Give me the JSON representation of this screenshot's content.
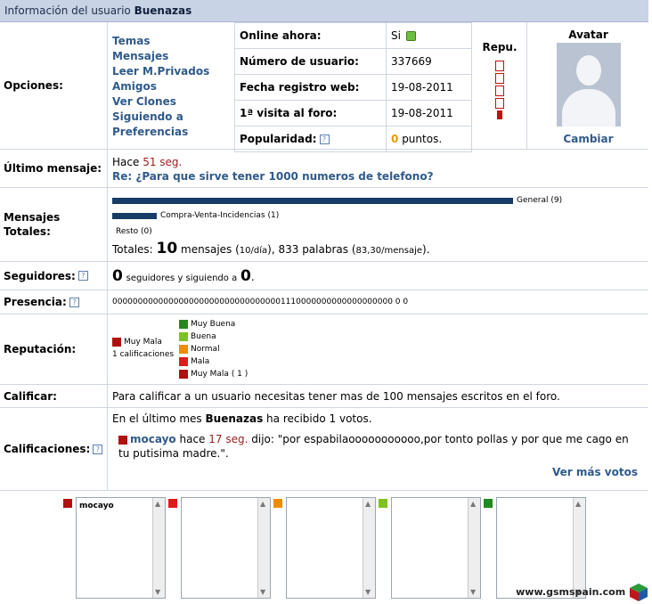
{
  "header": {
    "prefix": "Información del usuario",
    "username": "Buenazas"
  },
  "options": {
    "label": "Opciones:",
    "links": [
      "Temas",
      "Mensajes",
      "Leer M.Privados",
      "Amigos",
      "Ver Clones",
      "Siguiendo a",
      "Preferencias"
    ],
    "rows": [
      {
        "key": "Online ahora:",
        "value": "Si"
      },
      {
        "key": "Número de usuario:",
        "value": "337669"
      },
      {
        "key": "Fecha registro web:",
        "value": "19-08-2011"
      },
      {
        "key": "1ª visita al foro:",
        "value": "19-08-2011"
      },
      {
        "key": "Popularidad:",
        "value_num": "0",
        "value_suffix": "puntos."
      }
    ],
    "repu_title": "Repu.",
    "avatar_title": "Avatar",
    "avatar_change": "Cambiar"
  },
  "last_message": {
    "label": "Último mensaje:",
    "prefix": "Hace",
    "time": "51 seg.",
    "title": "Re: ¿Para que sirve tener 1000 numeros de telefono?"
  },
  "messages": {
    "label": "Mensajes Totales:",
    "bars": [
      {
        "name": "General (9)",
        "fraction": 0.9
      },
      {
        "name": "Compra-Venta-Incidencias (1)",
        "fraction": 0.1
      },
      {
        "name": "Resto (0)",
        "fraction": 0
      }
    ],
    "totals_prefix": "Totales:",
    "totals_count": "10",
    "totals_word": "mensajes",
    "per_day": "10/día",
    "words": "833 palabras",
    "per_msg": "83,30/mensaje"
  },
  "followers": {
    "label": "Seguidores:",
    "followers": "0",
    "middle": "seguidores y siguiendo a",
    "following": "0",
    "end": "."
  },
  "presence": {
    "label": "Presencia:",
    "value": "0000000000000000000000000000000001110000000000000000000 0 0"
  },
  "reputation": {
    "label": "Reputación:",
    "current": "Muy Mala",
    "count": "1 calificaciones",
    "legend": [
      {
        "name": "Muy Buena",
        "color": "#1f8a1f"
      },
      {
        "name": "Buena",
        "color": "#7ec21d"
      },
      {
        "name": "Normal",
        "color": "#f08a00"
      },
      {
        "name": "Mala",
        "color": "#e01b1b"
      },
      {
        "name": "Muy Mala ( 1 )",
        "color": "#b01010"
      }
    ]
  },
  "rate": {
    "label": "Calificar:",
    "text": "Para calificar a un usuario necesitas tener mas de 100 mensajes escritos en el foro."
  },
  "ratings": {
    "label": "Calificaciones:",
    "intro_prefix": "En el último mes",
    "intro_user": "Buenazas",
    "intro_suffix": "ha recibido 1 votos.",
    "vote_user": "mocayo",
    "vote_mid": "hace",
    "vote_time": "17 seg.",
    "vote_text": "dijo: \"por espabilaooooooooooo,por tonto pollas y por que me cago en tu putisima madre.\".",
    "more": "Ver más votos"
  },
  "vote_boxes": [
    {
      "color": "#b01010",
      "text": "mocayo"
    },
    {
      "color": "#e01b1b",
      "text": ""
    },
    {
      "color": "#f08a00",
      "text": ""
    },
    {
      "color": "#7ec21d",
      "text": ""
    },
    {
      "color": "#1f8a1f",
      "text": ""
    }
  ],
  "watermark": "www.gsmspain.com"
}
